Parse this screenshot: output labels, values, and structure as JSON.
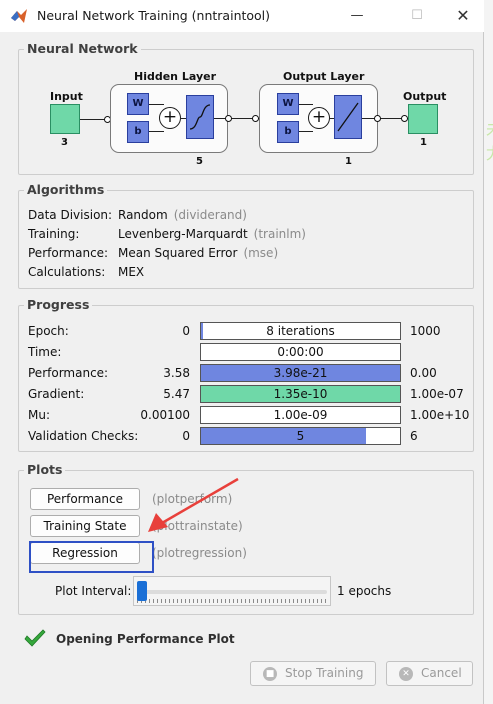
{
  "window": {
    "title": "Neural Network Training (nntraintool)",
    "minimize": "—",
    "maximize": "☐",
    "close": "✕"
  },
  "background_glyphs": [
    "未",
    "尤"
  ],
  "neural_network": {
    "section_title": "Neural Network",
    "input_label": "Input",
    "input_size": "3",
    "hidden_layer": {
      "title": "Hidden Layer",
      "weight": "W",
      "bias": "b",
      "size": "5",
      "transfer": "tansig"
    },
    "output_layer": {
      "title": "Output Layer",
      "weight": "W",
      "bias": "b",
      "size": "1",
      "transfer": "purelin"
    },
    "output_label": "Output",
    "output_size": "1",
    "plus": "+"
  },
  "algorithms": {
    "section_title": "Algorithms",
    "rows": [
      {
        "label": "Data Division:",
        "value": "Random",
        "fn": "(dividerand)"
      },
      {
        "label": "Training:",
        "value": "Levenberg-Marquardt",
        "fn": "(trainlm)"
      },
      {
        "label": "Performance:",
        "value": "Mean Squared Error",
        "fn": "(mse)"
      },
      {
        "label": "Calculations:",
        "value": "MEX",
        "fn": ""
      }
    ]
  },
  "progress": {
    "section_title": "Progress",
    "rows": [
      {
        "label": "Epoch:",
        "start": "0",
        "bar_text": "8 iterations",
        "end": "1000",
        "fill": 0.01,
        "fill_color": "#6f86e0"
      },
      {
        "label": "Time:",
        "start": "",
        "bar_text": "0:00:00",
        "end": "",
        "fill": 0.0,
        "fill_color": "#6f86e0"
      },
      {
        "label": "Performance:",
        "start": "3.58",
        "bar_text": "3.98e-21",
        "end": "0.00",
        "fill": 1.0,
        "fill_color": "#6f86e0"
      },
      {
        "label": "Gradient:",
        "start": "5.47",
        "bar_text": "1.35e-10",
        "end": "1.00e-07",
        "fill": 1.0,
        "fill_color": "#6fd8a8"
      },
      {
        "label": "Mu:",
        "start": "0.00100",
        "bar_text": "1.00e-09",
        "end": "1.00e+10",
        "fill": 0.0,
        "fill_color": "#6f86e0"
      },
      {
        "label": "Validation Checks:",
        "start": "0",
        "bar_text": "5",
        "end": "6",
        "fill": 0.83,
        "fill_color": "#6f86e0"
      }
    ]
  },
  "plots": {
    "section_title": "Plots",
    "buttons": [
      {
        "label": "Performance",
        "fn": "(plotperform)"
      },
      {
        "label": "Training State",
        "fn": "(plottrainstate)"
      },
      {
        "label": "Regression",
        "fn": "(plotregression)"
      }
    ],
    "plot_interval_label": "Plot Interval:",
    "plot_interval_value": "1 epochs",
    "slider_level": 0.0
  },
  "status": {
    "icon": "checkmark-icon",
    "text": "Opening Performance Plot"
  },
  "controls": {
    "stop_training": "Stop Training",
    "cancel": "Cancel"
  },
  "colors": {
    "annotation_arrow": "#e8403b",
    "highlight_box": "#2e50c5",
    "check_green": "#35a83c"
  }
}
